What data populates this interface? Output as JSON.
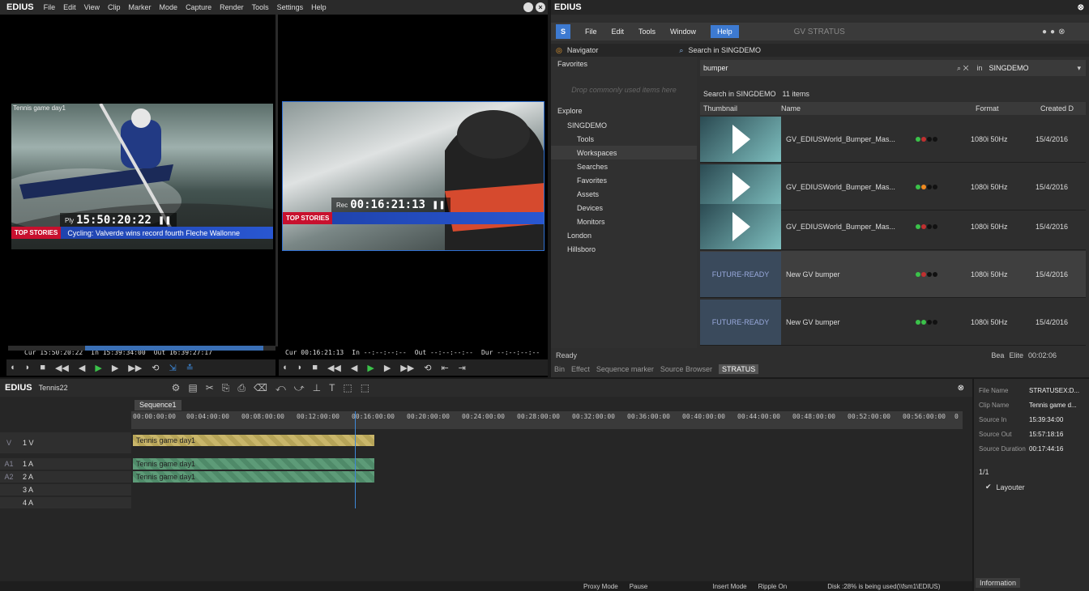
{
  "edius_top": {
    "logo": "EDIUS",
    "menu": [
      "File",
      "Edit",
      "View",
      "Clip",
      "Marker",
      "Mode",
      "Capture",
      "Render",
      "Tools",
      "Settings",
      "Help"
    ],
    "player": {
      "clip_label": "Tennis game day1",
      "timecode_prefix": "Ply",
      "timecode": "15:50:20:22",
      "lower_third_badge": "TOP STORIES",
      "lower_third_text": "Cycling: Valverde wins record fourth Fleche Wallonne",
      "cur": "Cur 15:50:20:22",
      "in": "In 15:39:34:00",
      "out": "Out 16:39:27:17"
    },
    "recorder": {
      "timecode_prefix": "Rec",
      "timecode": "00:16:21:13",
      "lower_third_badge": "TOP STORIES",
      "cur": "Cur 00:16:21:13",
      "in": "In --:--:--:--",
      "out": "Out --:--:--:--",
      "dur": "Dur --:--:--:--"
    }
  },
  "stratus": {
    "title": "EDIUS",
    "menu": [
      "File",
      "Edit",
      "Tools",
      "Window",
      "Help"
    ],
    "brand": "GV STRATUS",
    "tabs": {
      "navigator": "Navigator",
      "search": "Search in SINGDEMO"
    },
    "favorites_label": "Favorites",
    "drop_hint": "Drop commonly used items here",
    "explore_label": "Explore",
    "tree": [
      "SINGDEMO",
      "Tools",
      "Workspaces",
      "Searches",
      "Favorites",
      "Assets",
      "Devices",
      "Monitors",
      "London",
      "Hillsboro"
    ],
    "search_value": "bumper",
    "search_in": "in",
    "search_scope": "SINGDEMO",
    "results_label": "Search in SINGDEMO",
    "results_count": "11 items",
    "columns": [
      "Thumbnail",
      "Name",
      "Format",
      "Created D"
    ],
    "rows": [
      {
        "name": "GV_EDIUSWorld_Bumper_Mas...",
        "format": "1080i 50Hz",
        "created": "15/4/2016",
        "thumb": "GV"
      },
      {
        "name": "GV_EDIUSWorld_Bumper_Mas...",
        "format": "1080i 50Hz",
        "created": "15/4/2016",
        "thumb": "GV"
      },
      {
        "name": "GV_EDIUSWorld_Bumper_Mas...",
        "format": "1080i 50Hz",
        "created": "15/4/2016",
        "thumb": "GV"
      },
      {
        "name": "New GV bumper",
        "format": "1080i 50Hz",
        "created": "15/4/2016",
        "thumb": "FUTURE-READY"
      },
      {
        "name": "New GV bumper",
        "format": "1080i 50Hz",
        "created": "15/4/2016",
        "thumb": "FUTURE-READY"
      }
    ],
    "status": "Ready",
    "user": "Bea",
    "edition": "Elite",
    "time": "00:02:06",
    "bottom_tabs": [
      "Bin",
      "Effect",
      "Sequence marker",
      "Source Browser",
      "STRATUS"
    ]
  },
  "timeline": {
    "logo": "EDIUS",
    "project": "Tennis22",
    "sequence_tab": "Sequence1",
    "ruler": [
      "00:00:00:00",
      "00:04:00:00",
      "00:08:00:00",
      "00:12:00:00",
      "00:16:00:00",
      "00:20:00:00",
      "00:24:00:00",
      "00:28:00:00",
      "00:32:00:00",
      "00:36:00:00",
      "00:40:00:00",
      "00:44:00:00",
      "00:48:00:00",
      "00:52:00:00",
      "00:56:00:00",
      "0"
    ],
    "tracks": [
      {
        "label": "1 V",
        "patch": "V"
      },
      {
        "label": "1 A",
        "patch": "A1"
      },
      {
        "label": "2 A",
        "patch": "A2"
      },
      {
        "label": "3 A",
        "patch": ""
      },
      {
        "label": "4 A",
        "patch": ""
      }
    ],
    "clip_video": "Tennis game day1",
    "clip_audio1": "Tennis game day1",
    "clip_audio2": "Tennis game day1",
    "status": [
      "Proxy Mode",
      "Pause",
      "Insert Mode",
      "Ripple On",
      "Disk :28% is being used(\\\\fsm1\\EDIUS)"
    ]
  },
  "info": {
    "fields": [
      {
        "k": "File Name",
        "v": "STRATUSEX:D..."
      },
      {
        "k": "Clip Name",
        "v": "Tennis game d..."
      },
      {
        "k": "Source In",
        "v": "15:39:34:00"
      },
      {
        "k": "Source Out",
        "v": "15:57:18:16"
      },
      {
        "k": "Source Duration",
        "v": "00:17:44:16"
      }
    ],
    "layer_count": "1/1",
    "layer_item": "Layouter",
    "tab": "Information"
  }
}
